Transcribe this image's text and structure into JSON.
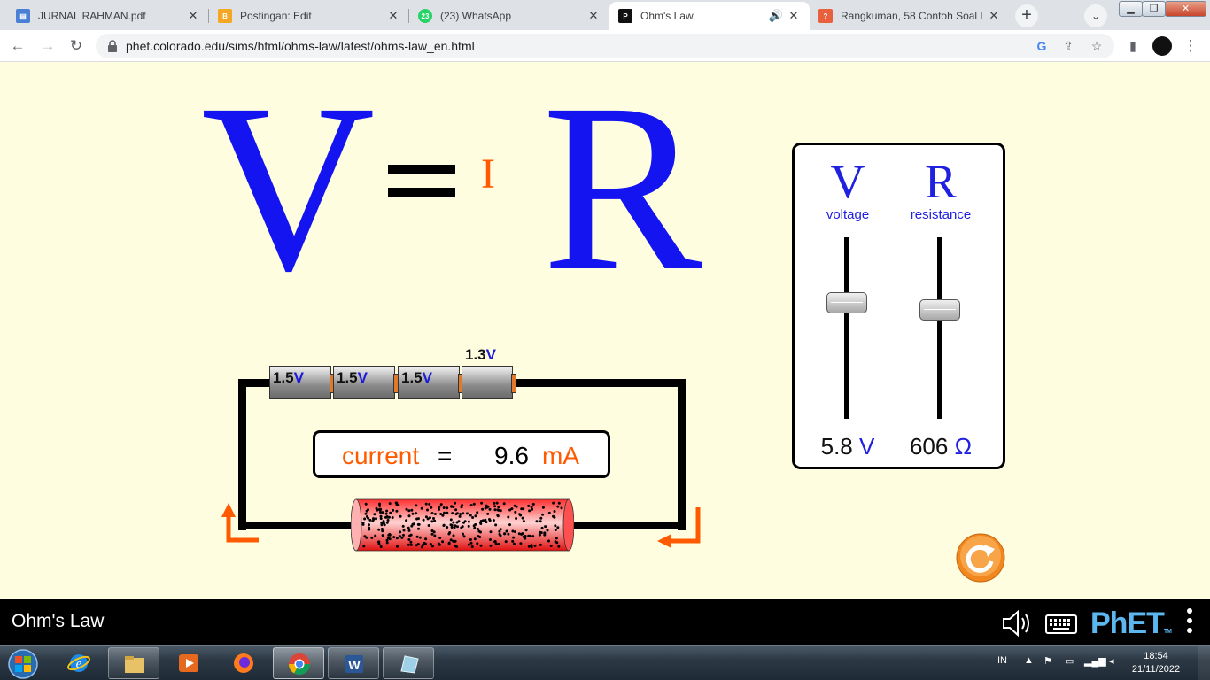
{
  "browser": {
    "tabs": [
      {
        "title": "JURNAL RAHMAN.pdf",
        "icon": "pdf-document-icon",
        "close": "✕"
      },
      {
        "title": "Postingan: Edit",
        "icon": "blogger-icon",
        "close": "✕"
      },
      {
        "title": "(23) WhatsApp",
        "icon": "whatsapp-icon",
        "badge": "23",
        "close": "✕"
      },
      {
        "title": "Ohm's Law",
        "icon": "phet-icon",
        "close": "✕",
        "audio": "🔊"
      },
      {
        "title": "Rangkuman, 58 Contoh Soal L",
        "icon": "question-favicon-icon",
        "close": "✕"
      }
    ],
    "new_tab": "+",
    "url": "phet.colorado.edu/sims/html/ohms-law/latest/ohms-law_en.html"
  },
  "sim": {
    "equation": {
      "V": "V",
      "equals": "=",
      "I": "I",
      "R": "R"
    },
    "controls": {
      "voltage": {
        "symbol": "V",
        "label": "voltage",
        "value": "5.8",
        "unit": "V",
        "min": 0.1,
        "max": 9.0
      },
      "resistance": {
        "symbol": "R",
        "label": "resistance",
        "value": "606",
        "unit": "Ω",
        "min": 10,
        "max": 1000
      }
    },
    "batteries": [
      {
        "value": "1.5",
        "unit": "V"
      },
      {
        "value": "1.5",
        "unit": "V"
      },
      {
        "value": "1.5",
        "unit": "V"
      },
      {
        "value": "1.3",
        "unit": "V"
      }
    ],
    "current": {
      "label": "current",
      "equals": "=",
      "value": "9.6",
      "unit": "mA"
    }
  },
  "phet": {
    "title": "Ohm's Law",
    "logo": "PhET",
    "trademark": "TM"
  },
  "taskbar": {
    "apps": [
      "windows-explorer-icon",
      "internet-explorer-icon",
      "file-explorer-icon",
      "media-player-icon",
      "firefox-icon",
      "chrome-icon",
      "word-icon",
      "notes-icon"
    ],
    "tray": {
      "lang": "IN",
      "time": "18:54",
      "date": "21/11/2022"
    }
  },
  "colors": {
    "blue": "#1414f0",
    "orange": "#ff5a00",
    "background": "#fffde0"
  }
}
